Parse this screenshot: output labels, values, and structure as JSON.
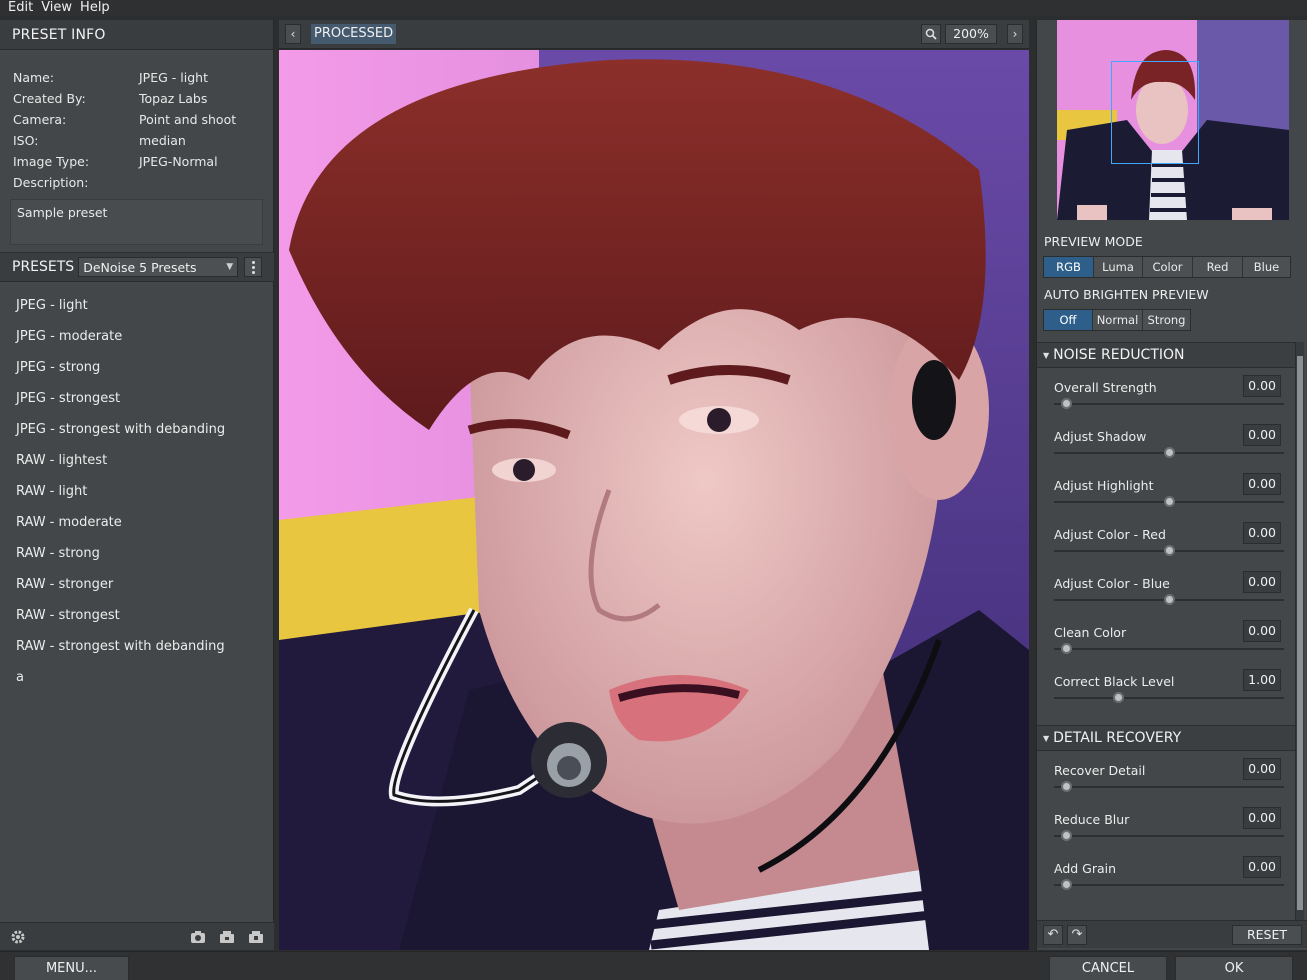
{
  "menu": {
    "items": [
      "Edit",
      "View",
      "Help"
    ]
  },
  "preset_info": {
    "title": "PRESET INFO",
    "rows": [
      {
        "key": "Name:",
        "value": "JPEG - light"
      },
      {
        "key": "Created By:",
        "value": "Topaz Labs"
      },
      {
        "key": "Camera:",
        "value": "Point and shoot"
      },
      {
        "key": "ISO:",
        "value": "median"
      },
      {
        "key": "Image Type:",
        "value": "JPEG-Normal"
      },
      {
        "key": "Description:",
        "value": ""
      }
    ],
    "description": "Sample preset"
  },
  "presets": {
    "title": "PRESETS",
    "selected_collection": "DeNoise 5 Presets",
    "items": [
      "JPEG - light",
      "JPEG - moderate",
      "JPEG - strong",
      "JPEG - strongest",
      "JPEG - strongest with debanding",
      "RAW - lightest",
      "RAW - light",
      "RAW - moderate",
      "RAW - strong",
      "RAW - stronger",
      "RAW - strongest",
      "RAW - strongest with debanding",
      "a"
    ]
  },
  "view": {
    "mode_label": "PROCESSED",
    "zoom": "200%"
  },
  "preview_mode": {
    "title": "PREVIEW MODE",
    "options": [
      "RGB",
      "Luma",
      "Color",
      "Red",
      "Blue"
    ],
    "active": "RGB"
  },
  "auto_brighten": {
    "title": "AUTO BRIGHTEN PREVIEW",
    "options": [
      "Off",
      "Normal",
      "Strong"
    ],
    "active": "Off"
  },
  "noise_reduction": {
    "title": "NOISE REDUCTION",
    "sliders": [
      {
        "label": "Overall Strength",
        "value": "0.00",
        "level": 0.05
      },
      {
        "label": "Adjust Shadow",
        "value": "0.00",
        "level": 0.5
      },
      {
        "label": "Adjust Highlight",
        "value": "0.00",
        "level": 0.5
      },
      {
        "label": "Adjust Color - Red",
        "value": "0.00",
        "level": 0.5
      },
      {
        "label": "Adjust Color - Blue",
        "value": "0.00",
        "level": 0.5
      },
      {
        "label": "Clean Color",
        "value": "0.00",
        "level": 0.05
      },
      {
        "label": "Correct Black Level",
        "value": "1.00",
        "level": 0.28
      }
    ]
  },
  "detail_recovery": {
    "title": "DETAIL RECOVERY",
    "sliders": [
      {
        "label": "Recover Detail",
        "value": "0.00",
        "level": 0.05
      },
      {
        "label": "Reduce Blur",
        "value": "0.00",
        "level": 0.05
      },
      {
        "label": "Add Grain",
        "value": "0.00",
        "level": 0.05
      }
    ]
  },
  "footer": {
    "reset_label": "RESET",
    "menu_label": "MENU...",
    "cancel_label": "CANCEL",
    "ok_label": "OK"
  },
  "colors": {
    "accent": "#2e5f8a",
    "navigator_box": "#3fa7ff",
    "panel_bg": "#434749"
  },
  "icons": [
    "settings-gear-icon",
    "camera-icon",
    "import-icon",
    "export-icon",
    "zoom-magnifier-icon",
    "undo-icon",
    "redo-icon"
  ]
}
